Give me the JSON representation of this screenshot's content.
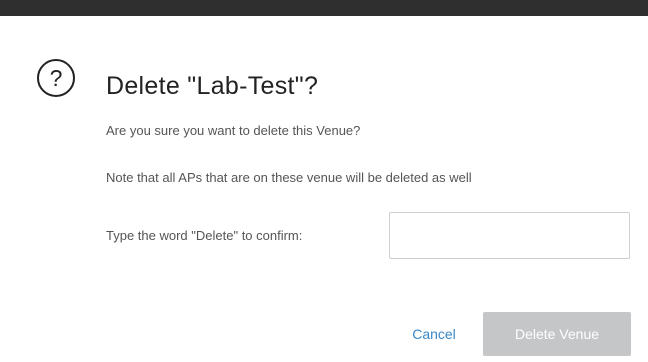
{
  "dialog": {
    "icon": "question-circle-icon",
    "icon_glyph": "?",
    "title": "Delete \"Lab-Test\"?",
    "message_1": "Are you sure you want to delete this Venue?",
    "message_2": "Note that all APs that are on these venue will be deleted as well",
    "confirm_label": "Type the word \"Delete\" to confirm:",
    "confirm_value": "",
    "cancel_label": "Cancel",
    "delete_label": "Delete Venue",
    "delete_enabled": false
  },
  "colors": {
    "header_bar": "#2f2f2f",
    "link_blue": "#3a88c9",
    "disabled_button": "#c4c6c8"
  }
}
